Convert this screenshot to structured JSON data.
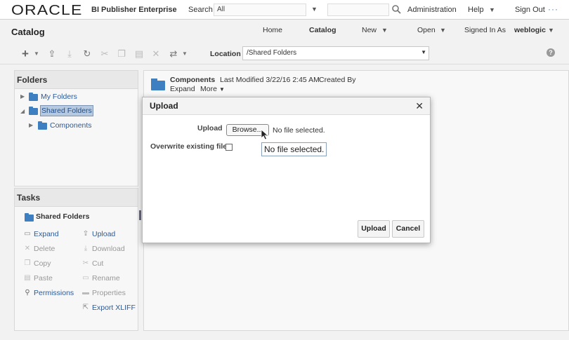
{
  "banner": {
    "logo": "ORACLE",
    "product": "BI Publisher Enterprise",
    "search_label": "Search",
    "search_scope": "All",
    "links": {
      "administration": "Administration",
      "help": "Help",
      "sign_out": "Sign Out"
    },
    "more": "···"
  },
  "header": {
    "title": "Catalog",
    "nav": {
      "home": "Home",
      "catalog": "Catalog",
      "new": "New",
      "open": "Open",
      "signed_in_as": "Signed In As",
      "user": "weblogic"
    }
  },
  "toolbar": {
    "location_label": "Location",
    "location_value": "/Shared Folders",
    "icons": [
      "plus-icon",
      "upload-icon",
      "download-icon",
      "refresh-icon",
      "cut-icon",
      "copy-icon",
      "paste-icon",
      "delete-icon",
      "swap-icon",
      "help-icon"
    ]
  },
  "folders_panel": {
    "title": "Folders",
    "items": [
      {
        "label": "My Folders"
      },
      {
        "label": "Shared Folders"
      },
      {
        "label": "Components"
      }
    ]
  },
  "tasks_panel": {
    "title": "Tasks",
    "context": "Shared Folders",
    "tasks": [
      {
        "label": "Expand"
      },
      {
        "label": "Upload"
      },
      {
        "label": "Delete"
      },
      {
        "label": "Download"
      },
      {
        "label": "Copy"
      },
      {
        "label": "Cut"
      },
      {
        "label": "Paste"
      },
      {
        "label": "Rename"
      },
      {
        "label": "Permissions"
      },
      {
        "label": "Properties"
      },
      {
        "label": "Export XLIFF"
      }
    ]
  },
  "content": {
    "item_name": "Components",
    "last_modified": "Last Modified 3/22/16 2:45 AM",
    "created_by": "Created By",
    "expand": "Expand",
    "more": "More"
  },
  "dialog": {
    "title": "Upload",
    "close": "✕",
    "upload_label": "Upload",
    "browse": "Browse...",
    "no_file": "No file selected.",
    "overwrite_label": "Overwrite existing file",
    "overwrite_checked": false,
    "tooltip": "No file selected.",
    "upload_button": "Upload",
    "cancel_button": "Cancel"
  }
}
